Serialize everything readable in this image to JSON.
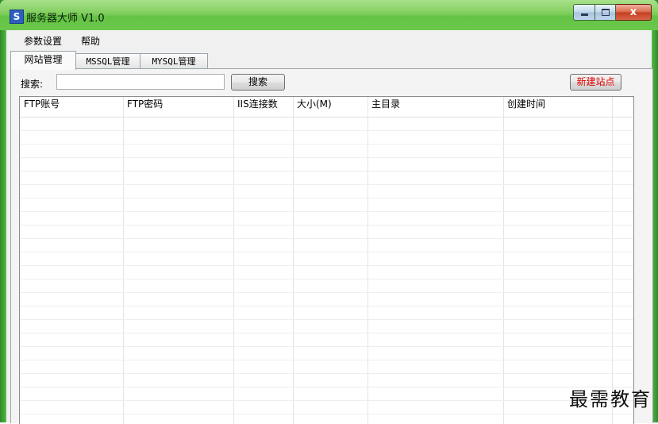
{
  "window": {
    "icon_letter": "S",
    "title": "服务器大师 V1.0",
    "close_glyph": "x"
  },
  "menu": {
    "items": [
      {
        "label": "参数设置"
      },
      {
        "label": "帮助"
      }
    ]
  },
  "tabs": [
    {
      "label": "网站管理",
      "active": true
    },
    {
      "label": "MSSQL管理",
      "active": false
    },
    {
      "label": "MYSQL管理",
      "active": false
    }
  ],
  "search": {
    "label": "搜索:",
    "value": "",
    "placeholder": "",
    "button_label": "搜索"
  },
  "new_site_button": {
    "label": "新建站点",
    "color": "#e00000"
  },
  "table": {
    "columns": [
      {
        "label": "FTP账号"
      },
      {
        "label": "FTP密码"
      },
      {
        "label": "IIS连接数"
      },
      {
        "label": "大小(M)"
      },
      {
        "label": "主目录"
      },
      {
        "label": "创建时间"
      }
    ],
    "rows": []
  },
  "watermark": "最需教育",
  "colors": {
    "frame_green": "#5cc24a",
    "title_green": "#7fce5d",
    "close_red": "#c43e1f"
  }
}
